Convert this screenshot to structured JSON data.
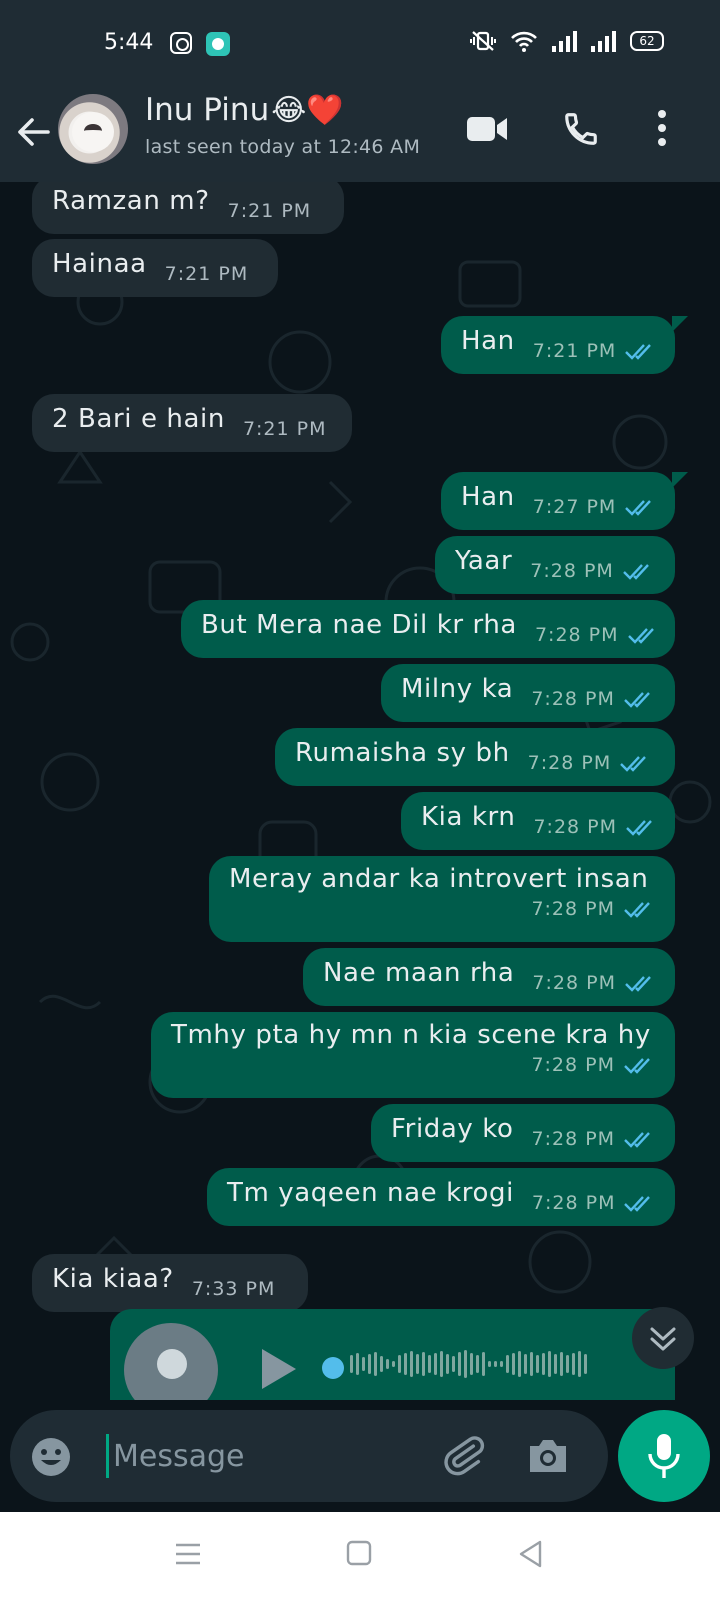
{
  "status_bar": {
    "time": "5:44",
    "battery": "62"
  },
  "header": {
    "contact_name": "Inu Pinu",
    "contact_emoji": "😂❤️",
    "last_seen": "last seen today at 12:46 AM"
  },
  "messages": [
    {
      "dir": "in",
      "text": "Ramzan m?",
      "time": "7:21 PM"
    },
    {
      "dir": "in",
      "text": "Hainaa",
      "time": "7:21 PM"
    },
    {
      "dir": "out",
      "text": "Han",
      "time": "7:21 PM"
    },
    {
      "dir": "in",
      "text": "2 Bari e hain",
      "time": "7:21 PM"
    },
    {
      "dir": "out",
      "text": "Han",
      "time": "7:27 PM"
    },
    {
      "dir": "out",
      "text": "Yaar",
      "time": "7:28 PM"
    },
    {
      "dir": "out",
      "text": "But Mera nae Dil kr rha",
      "time": "7:28 PM"
    },
    {
      "dir": "out",
      "text": "Milny ka",
      "time": "7:28 PM"
    },
    {
      "dir": "out",
      "text": "Rumaisha sy bh",
      "time": "7:28 PM"
    },
    {
      "dir": "out",
      "text": "Kia krn",
      "time": "7:28 PM"
    },
    {
      "dir": "out",
      "text": "Meray andar ka introvert insan",
      "time": "7:28 PM"
    },
    {
      "dir": "out",
      "text": "Nae maan rha",
      "time": "7:28 PM"
    },
    {
      "dir": "out",
      "text": "Tmhy pta hy mn n kia scene kra hy",
      "time": "7:28 PM"
    },
    {
      "dir": "out",
      "text": "Friday ko",
      "time": "7:28 PM"
    },
    {
      "dir": "out",
      "text": "Tm yaqeen nae krogi",
      "time": "7:28 PM"
    },
    {
      "dir": "in",
      "text": "Kia kiaa?",
      "time": "7:33 PM"
    }
  ],
  "input": {
    "placeholder": "Message"
  },
  "colors": {
    "incoming_bubble": "#202c33",
    "outgoing_bubble": "#005c4b",
    "read_ticks": "#53bdeb",
    "accent": "#00a884"
  },
  "icons": [
    "back-arrow-icon",
    "video-call-icon",
    "phone-icon",
    "more-options-icon",
    "emoji-icon",
    "attach-icon",
    "camera-icon",
    "mic-icon",
    "scroll-down-icon",
    "play-icon",
    "recents-icon",
    "home-icon",
    "back-nav-icon"
  ]
}
